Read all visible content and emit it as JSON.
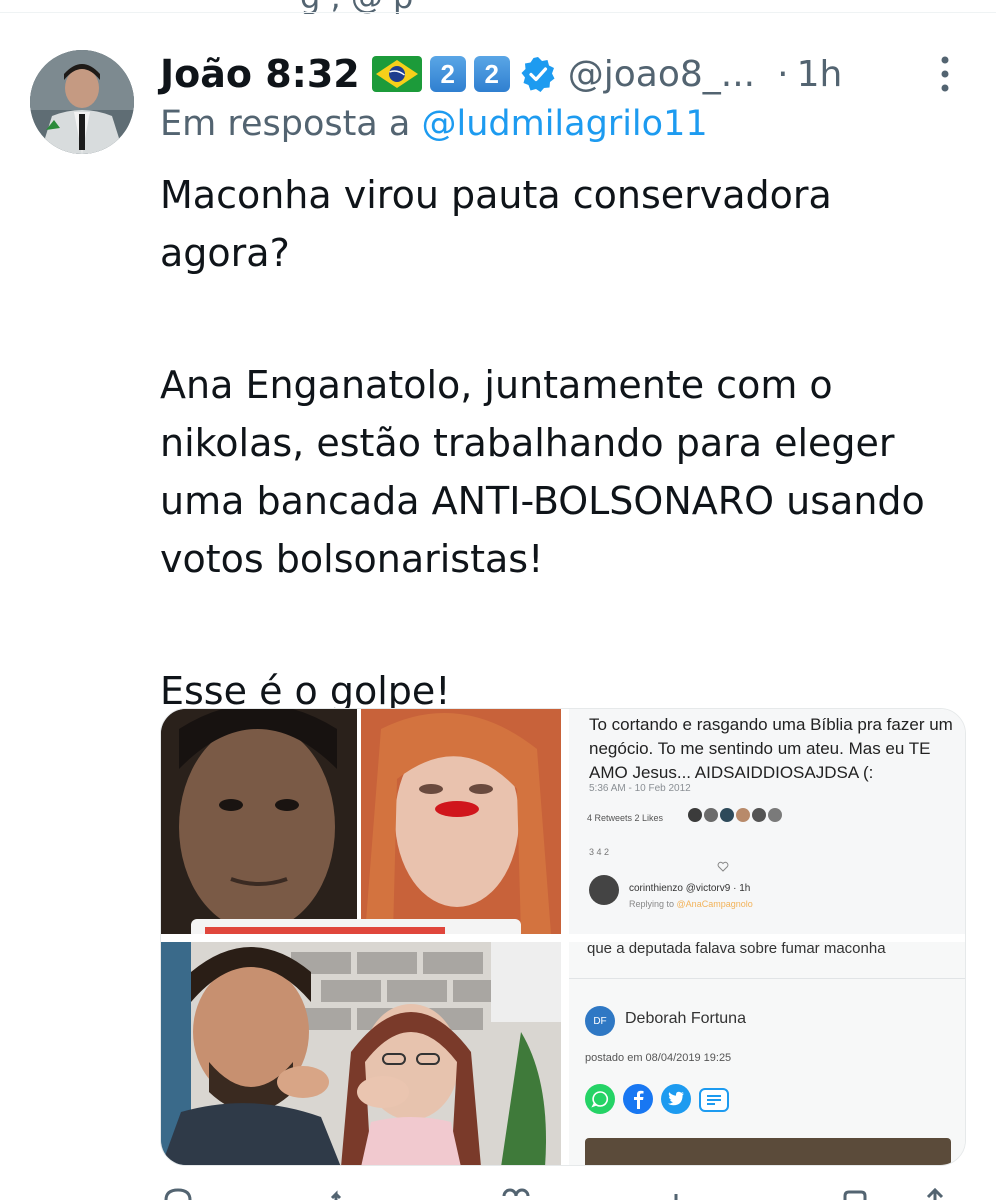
{
  "tweet": {
    "author_name": "João 8:32",
    "flag_emoji": "brazil-flag",
    "keycap_1": "2",
    "keycap_2": "2",
    "handle": "@joao8_...",
    "separator": "·",
    "time": "1h",
    "reply_prefix": "Em resposta a",
    "reply_mention": "@ludmilagrilo11",
    "paragraphs": [
      "Maconha virou pauta conservadora agora?",
      "Ana Enganatolo, juntamente com o nikolas, estão trabalhando para eleger uma bancada ANTI-BOLSONARO usando votos bolsonaristas!",
      "Esse é o golpe!"
    ]
  },
  "media": {
    "screenshot_tweet": {
      "text": "To cortando e rasgando uma Bíblia pra fazer um negócio. To me sentindo um ateu. Mas eu TE AMO Jesus... AIDSAIDDIOSAJDSA (:",
      "date": "5:36 AM - 10 Feb 2012",
      "stats": "4 Retweets  2 Likes",
      "actions": "3        4            2",
      "reply_user": "corinthienzo @victorv9 · 1h",
      "replying_prefix": "Replying to",
      "replying_to": "@AnaCampagnolo"
    },
    "article": {
      "headline": "que a deputada falava sobre fumar maconha",
      "author_initials": "DF",
      "author": "Deborah Fortuna",
      "posted": "postado em 08/04/2019 19:25"
    }
  },
  "colors": {
    "link": "#1d9bf0",
    "secondary_text": "#536471",
    "primary_text": "#0f1419",
    "verified": "#1d9bf0"
  },
  "icons": [
    "verified-badge-icon",
    "more-options-icon",
    "reply-icon",
    "retweet-icon",
    "like-icon",
    "views-icon",
    "bookmark-icon",
    "share-icon"
  ]
}
